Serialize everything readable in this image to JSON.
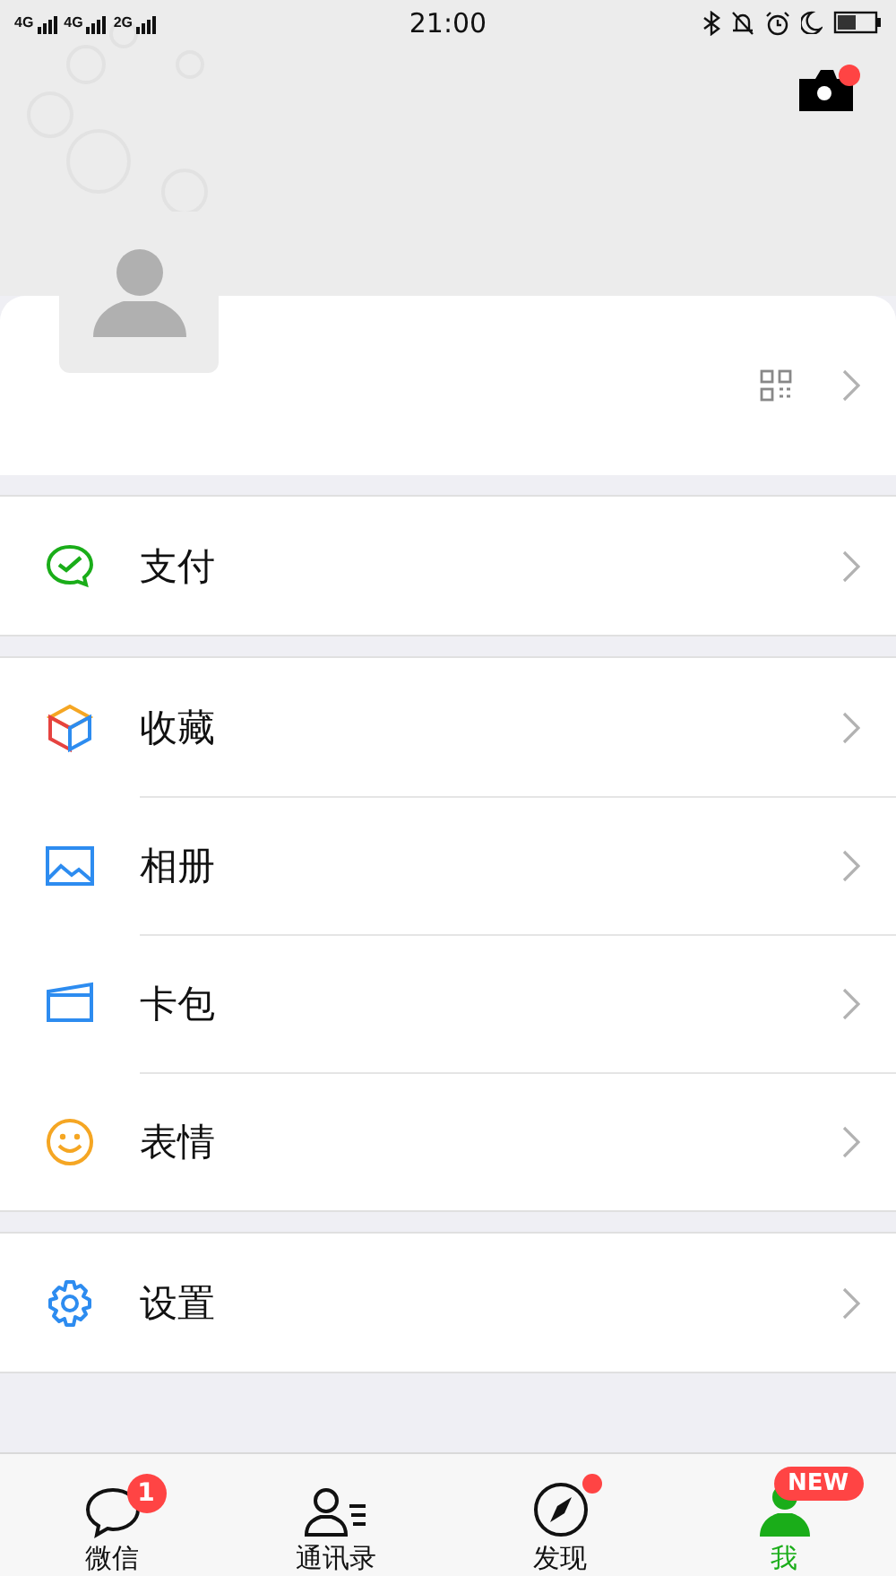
{
  "status_bar": {
    "networks": [
      "4G",
      "4G",
      "2G"
    ],
    "time": "21:00"
  },
  "header": {
    "camera_badge": true
  },
  "menu_groups": [
    [
      {
        "label": "支付"
      }
    ],
    [
      {
        "label": "收藏"
      },
      {
        "label": "相册"
      },
      {
        "label": "卡包"
      },
      {
        "label": "表情"
      }
    ],
    [
      {
        "label": "设置"
      }
    ]
  ],
  "tabs": [
    {
      "label": "微信",
      "selected": false,
      "badge": {
        "kind": "count",
        "text": "1"
      }
    },
    {
      "label": "通讯录",
      "selected": false
    },
    {
      "label": "发现",
      "selected": false,
      "badge": {
        "kind": "dot"
      }
    },
    {
      "label": "我",
      "selected": true,
      "badge": {
        "kind": "pill",
        "text": "NEW"
      }
    }
  ]
}
